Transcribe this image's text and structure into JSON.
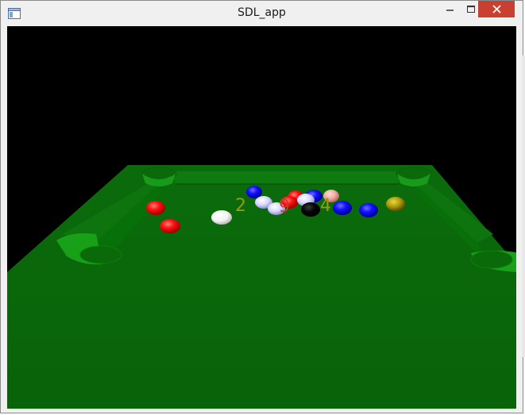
{
  "window": {
    "title": "SDL_app",
    "icon": "app-window-icon",
    "controls": [
      "minimize-icon",
      "maximize-icon",
      "close-icon"
    ]
  },
  "scene": {
    "table_color": "#0a6a0a",
    "background_color": "#000000",
    "ball_labels": [
      "2",
      "9",
      "4"
    ],
    "ball_label_color": "#9a9a10",
    "ball_colors": {
      "red": "#ff1010",
      "blue": "#1010ff",
      "white": "#ffffff",
      "black": "#050505",
      "yellow": "#b0a010",
      "pink": "#f4a9a0",
      "lavender": "#d8d8ff"
    }
  }
}
